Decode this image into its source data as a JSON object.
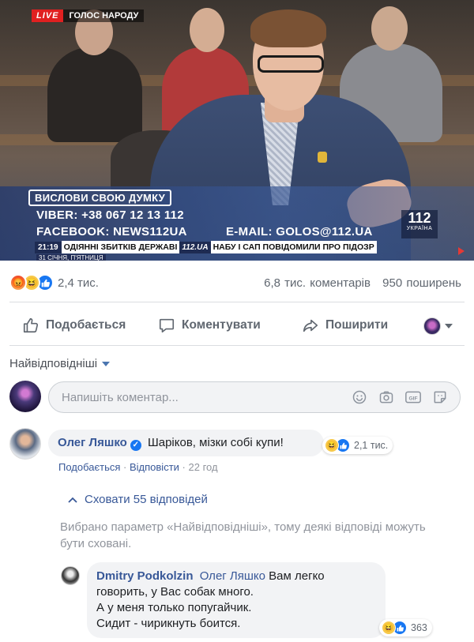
{
  "video": {
    "live_label": "LIVE",
    "show_name": "ГОЛОС НАРОДУ",
    "prompt": "ВИСЛОВИ СВОЮ ДУМКУ",
    "viber": "VIBER: +38 067 12 13 112",
    "facebook": "FACEBOOK: NEWS112UA",
    "email": "E-MAIL: GOLOS@112.UA",
    "channel_number": "112",
    "channel_country": "УКРАЇНА",
    "ticker_time": "21:19",
    "ticker_text_left": "ОДІЯННІ ЗБИТКІВ ДЕРЖАВІ",
    "ticker_brand": "112.UA",
    "ticker_text_right": "НАБУ І САП ПОВІДОМИЛИ ПРО ПІДОЗР",
    "date": "31 СІЧНЯ, П'ЯТНИЦЯ"
  },
  "post_stats": {
    "reactions_count": "2,4 тис.",
    "comments": "6,8 тис. коментарів",
    "shares": "950 поширень"
  },
  "actions": {
    "like": "Подобається",
    "comment": "Коментувати",
    "share": "Поширити"
  },
  "comments_filter": "Найвідповідніші",
  "composer_placeholder": "Напишіть коментар...",
  "comment1": {
    "author": "Олег Ляшко",
    "text": "Шаріков, мізки собі купи!",
    "reactions": "2,1 тис.",
    "like": "Подобається",
    "separator": "·",
    "reply": "Відповісти",
    "time": "22 год"
  },
  "hide_replies": "Сховати 55 відповідей",
  "notice": "Вибрано параметр «Найвідповідніші», тому деякі відповіді можуть бути сховані.",
  "reply1": {
    "author": "Dmitry Podkolzin",
    "mention": "Олег Ляшко",
    "line1": "Вам легко",
    "line2": "говорить, у Вас собак много.",
    "line3": "А у меня только попугайчик.",
    "line4": "Сидит - чирикнуть боится.",
    "reactions": "363"
  }
}
